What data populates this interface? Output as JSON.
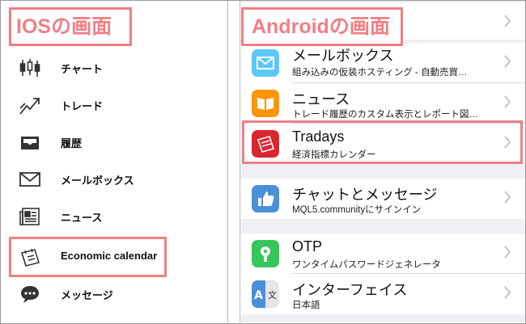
{
  "ios": {
    "title": "IOSの画面",
    "items": [
      {
        "label": "チャート",
        "icon": "candlestick-chart-icon"
      },
      {
        "label": "トレード",
        "icon": "trade-trend-icon"
      },
      {
        "label": "履歴",
        "icon": "history-tray-icon"
      },
      {
        "label": "メールボックス",
        "icon": "mail-envelope-icon"
      },
      {
        "label": "ニュース",
        "icon": "news-icon"
      },
      {
        "label": "Economic calendar",
        "icon": "economic-calendar-icon"
      },
      {
        "label": "メッセージ",
        "icon": "message-bubble-icon"
      }
    ]
  },
  "android": {
    "title": "Androidの画面",
    "rows": [
      {
        "title": "",
        "subtitle": "",
        "icon": "chevron-right-icon"
      },
      {
        "title": "メールボックス",
        "subtitle": "組み込みの仮装ホスティング - 自動売買…",
        "icon": "mail-icon",
        "color": "#5ac8fa"
      },
      {
        "title": "ニュース",
        "subtitle": "トレード履歴のカスタム表示とレポート図…",
        "icon": "news-book-icon",
        "color": "#ff9500"
      },
      {
        "title": "Tradays",
        "subtitle": "経済指標カレンダー",
        "icon": "tradays-calendar-icon",
        "color": "#d9252f"
      },
      {
        "title": "チャットとメッセージ",
        "subtitle": "MQL5.communityにサインイン",
        "icon": "chat-thumb-icon",
        "color": "#4a90d9"
      },
      {
        "title": "OTP",
        "subtitle": "ワンタイムパスワードジェネレータ",
        "icon": "otp-lock-icon",
        "color": "#34c759"
      },
      {
        "title": "インターフェイス",
        "subtitle": "日本語",
        "icon": "interface-language-icon",
        "color": "#4a90d9"
      }
    ]
  }
}
